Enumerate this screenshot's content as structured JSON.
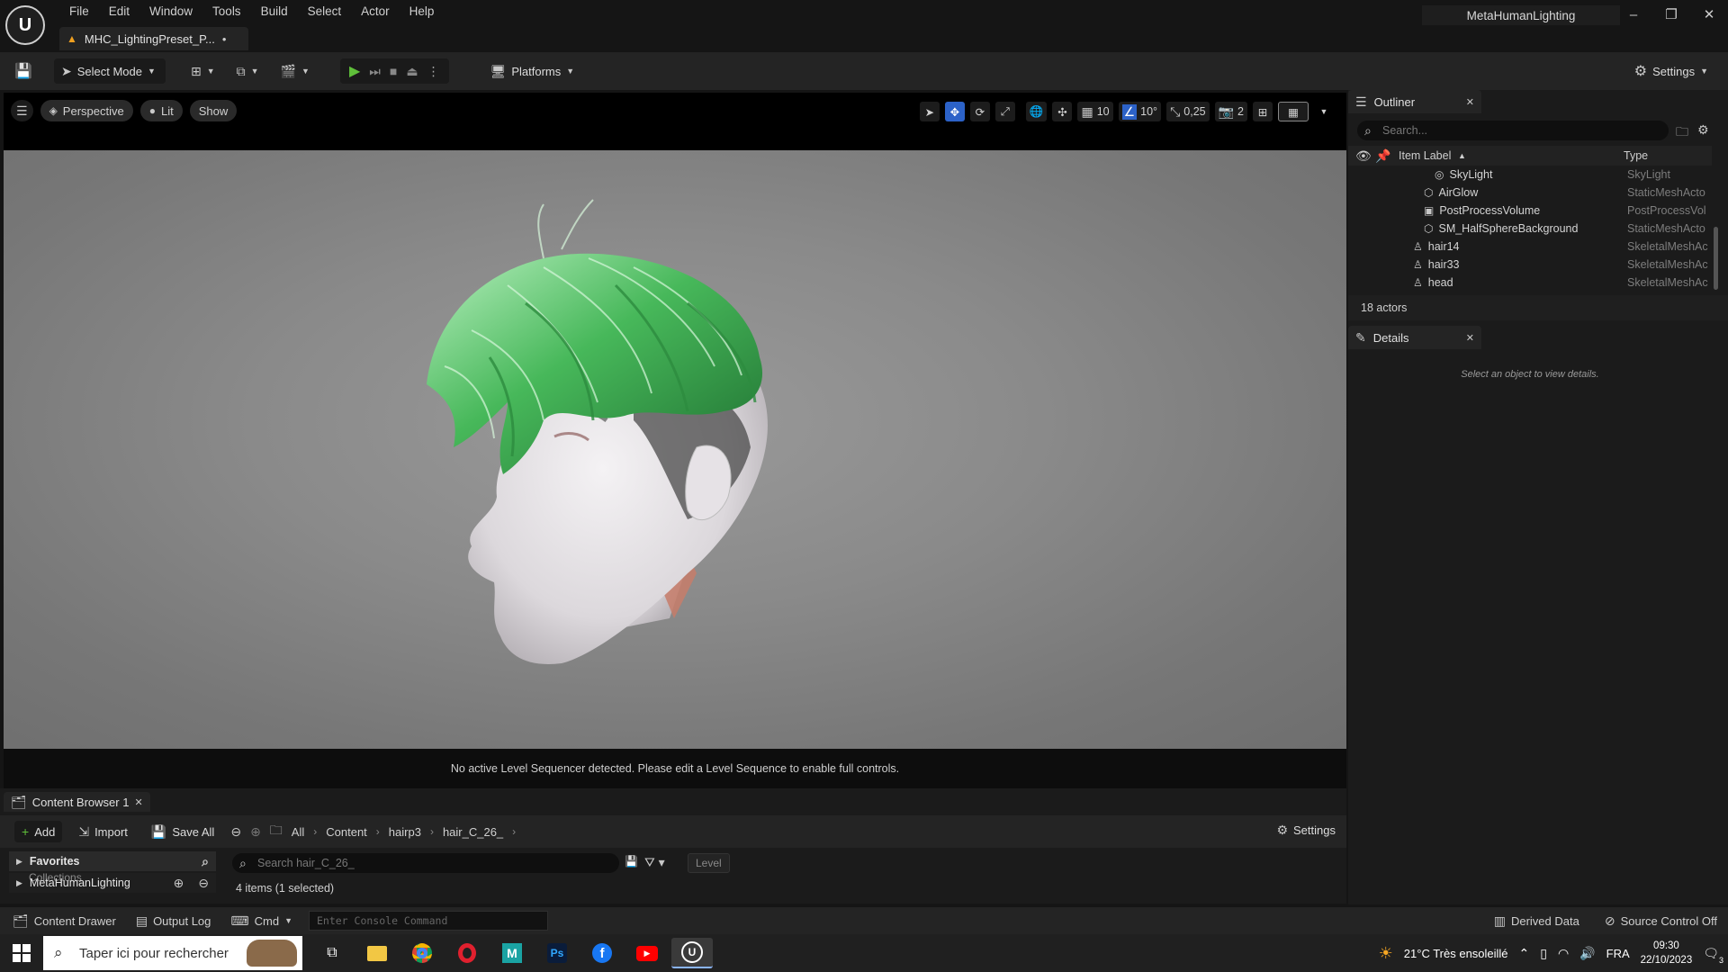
{
  "app": {
    "project_name": "MetaHumanLighting",
    "doc_tab": "MHC_LightingPreset_P...",
    "doc_tab_dirty": "•"
  },
  "menu": [
    "File",
    "Edit",
    "Window",
    "Tools",
    "Build",
    "Select",
    "Actor",
    "Help"
  ],
  "toolbar": {
    "select_mode": "Select Mode",
    "platforms": "Platforms",
    "settings": "Settings"
  },
  "viewport": {
    "perspective": "Perspective",
    "lit": "Lit",
    "show": "Show",
    "grid_snap": "10",
    "rotation_snap": "10°",
    "scale_snap": "0,25",
    "camera_speed": "2",
    "sequencer_message": "No active Level Sequencer detected. Please edit a Level Sequence to enable full controls."
  },
  "outliner": {
    "title": "Outliner",
    "search_placeholder": "Search...",
    "col_label": "Item Label",
    "col_type": "Type",
    "rows": [
      {
        "label": "SkyLight",
        "type": "SkyLight",
        "indent": "2",
        "icon": "skylight-icon"
      },
      {
        "label": "AirGlow",
        "type": "StaticMeshActo",
        "indent": "1",
        "icon": "static-mesh-icon"
      },
      {
        "label": "PostProcessVolume",
        "type": "PostProcessVol",
        "indent": "1",
        "icon": "post-process-icon"
      },
      {
        "label": "SM_HalfSphereBackground",
        "type": "StaticMeshActo",
        "indent": "1",
        "icon": "static-mesh-icon"
      },
      {
        "label": "hair14",
        "type": "SkeletalMeshAc",
        "indent": "0",
        "icon": "skeletal-mesh-icon"
      },
      {
        "label": "hair33",
        "type": "SkeletalMeshAc",
        "indent": "0",
        "icon": "skeletal-mesh-icon"
      },
      {
        "label": "head",
        "type": "SkeletalMeshAc",
        "indent": "0",
        "icon": "skeletal-mesh-icon"
      }
    ],
    "actor_count": "18 actors"
  },
  "details": {
    "title": "Details",
    "empty_message": "Select an object to view details."
  },
  "content_browser": {
    "tab": "Content Browser 1",
    "add": "Add",
    "import": "Import",
    "save_all": "Save All",
    "breadcrumbs": [
      "All",
      "Content",
      "hairp3",
      "hair_C_26_"
    ],
    "settings": "Settings",
    "favorites": "Favorites",
    "collections": "Collections",
    "project_folder": "MetaHumanLighting",
    "search_placeholder": "Search hair_C_26_",
    "level_filter": "Level",
    "items_count": "4 items (1 selected)"
  },
  "statusbar": {
    "content_drawer": "Content Drawer",
    "output_log": "Output Log",
    "cmd": "Cmd",
    "console_placeholder": "Enter Console Command",
    "derived_data": "Derived Data",
    "source_control": "Source Control Off"
  },
  "taskbar": {
    "search_placeholder": "Taper ici pour rechercher",
    "weather": "21°C  Très ensoleillé",
    "language": "FRA",
    "time": "09:30",
    "date": "22/10/2023",
    "notification_count": "3"
  },
  "colors": {
    "accent_blue": "#2c62c8",
    "play_green": "#5fbf3a",
    "hair_green": "#3fa84e",
    "background": "#151515"
  }
}
